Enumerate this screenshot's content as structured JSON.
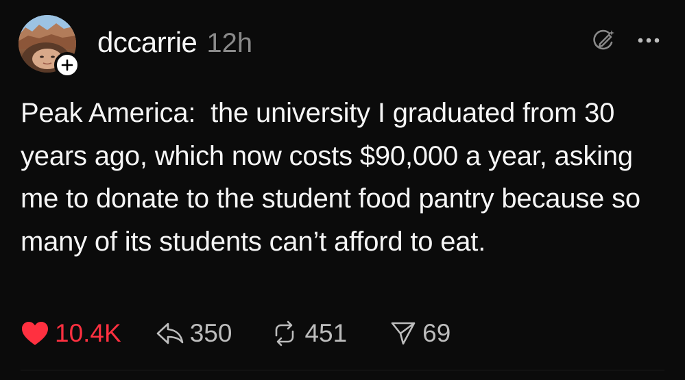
{
  "post": {
    "username": "dccarrie",
    "timestamp": "12h",
    "text": "Peak America:  the university I graduated from 30 years ago, which now costs $90,000 a year, asking me to donate to the student food pantry because so many of its students can’t afford to eat.",
    "actions": {
      "likes": "10.4K",
      "replies": "350",
      "reposts": "451",
      "shares": "69"
    }
  },
  "colors": {
    "background": "#0b0b0b",
    "text": "#f5f5f5",
    "muted": "#8a8a8a",
    "like_red": "#ff3040"
  },
  "icons": {
    "avatar": "avatar",
    "follow": "plus-icon",
    "ai_summary": "edit-sparkle-icon",
    "more": "more-icon",
    "like": "heart-icon",
    "reply": "reply-icon",
    "repost": "repost-icon",
    "share": "send-icon"
  }
}
